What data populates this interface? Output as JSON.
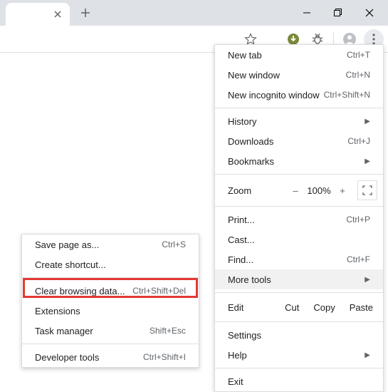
{
  "window": {
    "minimize": "–",
    "maximize": "❐",
    "close": "✕"
  },
  "toolbar": {
    "star": "star-icon",
    "idm": "idm-icon",
    "bug": "bug-icon",
    "profile": "profile-icon",
    "more": "more-icon"
  },
  "main_menu": {
    "new_tab": {
      "label": "New tab",
      "shortcut": "Ctrl+T"
    },
    "new_window": {
      "label": "New window",
      "shortcut": "Ctrl+N"
    },
    "new_incognito": {
      "label": "New incognito window",
      "shortcut": "Ctrl+Shift+N"
    },
    "history": {
      "label": "History"
    },
    "downloads": {
      "label": "Downloads",
      "shortcut": "Ctrl+J"
    },
    "bookmarks": {
      "label": "Bookmarks"
    },
    "zoom": {
      "label": "Zoom",
      "minus": "–",
      "value": "100%",
      "plus": "+"
    },
    "print": {
      "label": "Print...",
      "shortcut": "Ctrl+P"
    },
    "cast": {
      "label": "Cast..."
    },
    "find": {
      "label": "Find...",
      "shortcut": "Ctrl+F"
    },
    "more_tools": {
      "label": "More tools"
    },
    "edit": {
      "label": "Edit",
      "cut": "Cut",
      "copy": "Copy",
      "paste": "Paste"
    },
    "settings": {
      "label": "Settings"
    },
    "help": {
      "label": "Help"
    },
    "exit": {
      "label": "Exit"
    }
  },
  "sub_menu": {
    "save_page": {
      "label": "Save page as...",
      "shortcut": "Ctrl+S"
    },
    "create_shortcut": {
      "label": "Create shortcut..."
    },
    "clear_data": {
      "label": "Clear browsing data...",
      "shortcut": "Ctrl+Shift+Del"
    },
    "extensions": {
      "label": "Extensions"
    },
    "task_manager": {
      "label": "Task manager",
      "shortcut": "Shift+Esc"
    },
    "dev_tools": {
      "label": "Developer tools",
      "shortcut": "Ctrl+Shift+I"
    }
  }
}
